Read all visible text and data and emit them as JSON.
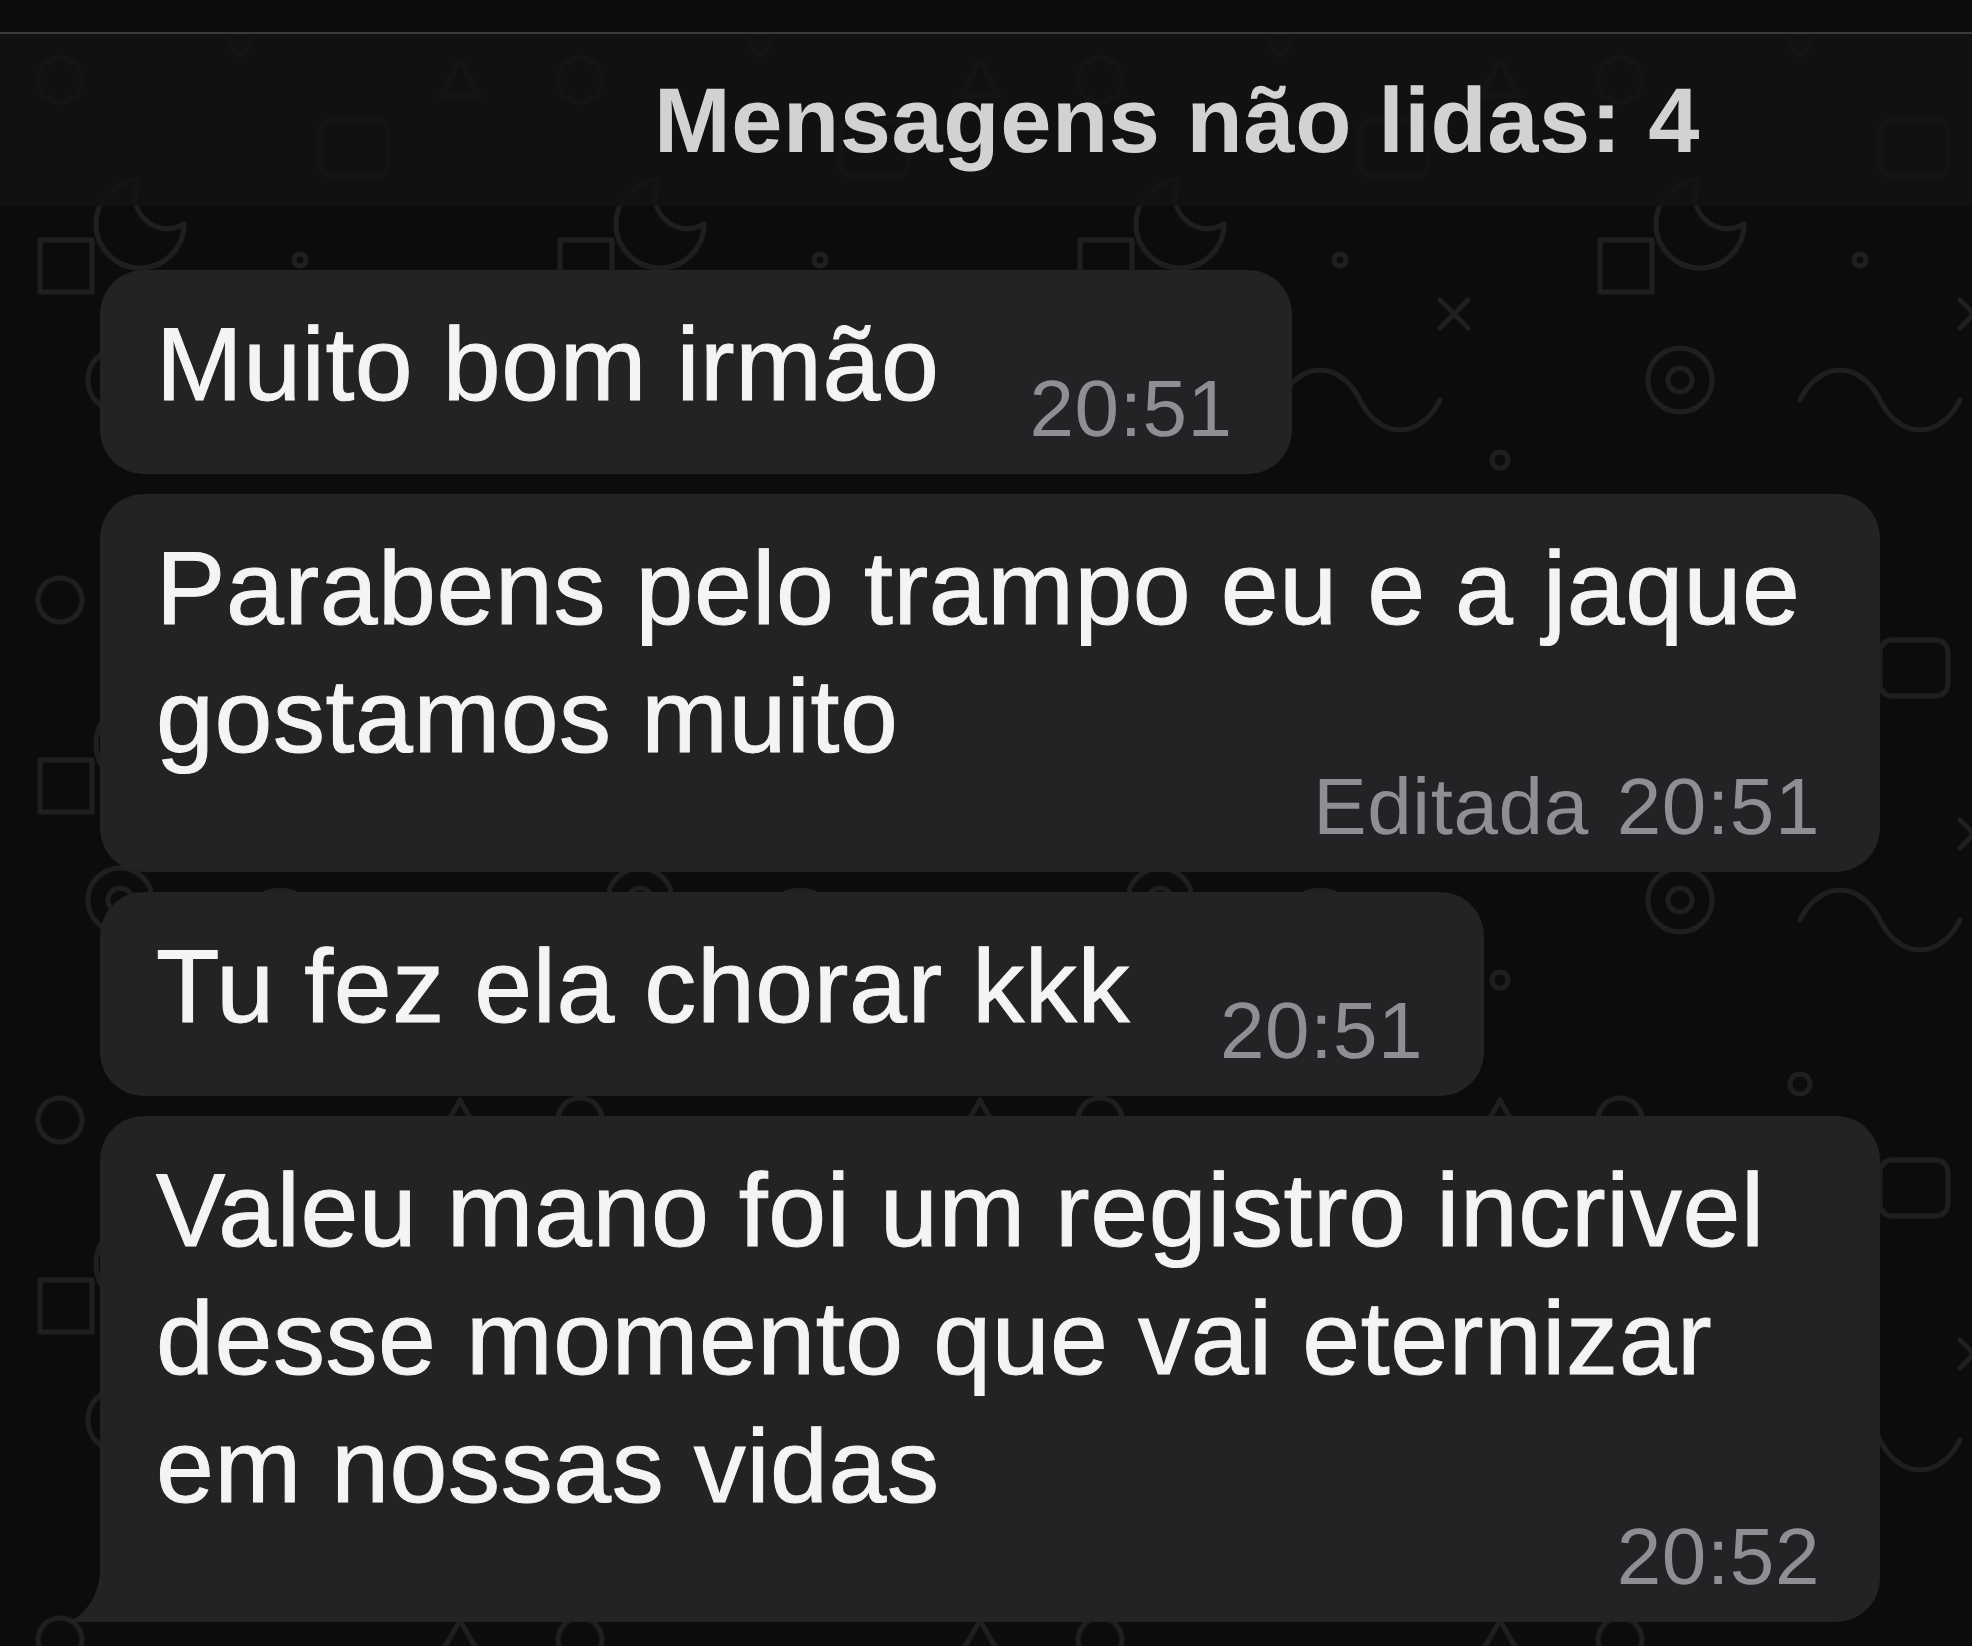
{
  "unread_banner": {
    "label": "Mensagens não lidas: 4"
  },
  "messages": [
    {
      "text": "Muito bom irmão",
      "time": "20:51",
      "tail": false
    },
    {
      "text": "Parabens pelo trampo eu e a jaque gostamos muito",
      "edited_label": "Editada",
      "time": "20:51",
      "tail": false
    },
    {
      "text": "Tu fez ela chorar kkk",
      "time": "20:51",
      "tail": false
    },
    {
      "text": "Valeu mano foi um registro incrivel desse momento que vai eternizar em nossas vidas",
      "time": "20:52",
      "tail": true
    }
  ]
}
